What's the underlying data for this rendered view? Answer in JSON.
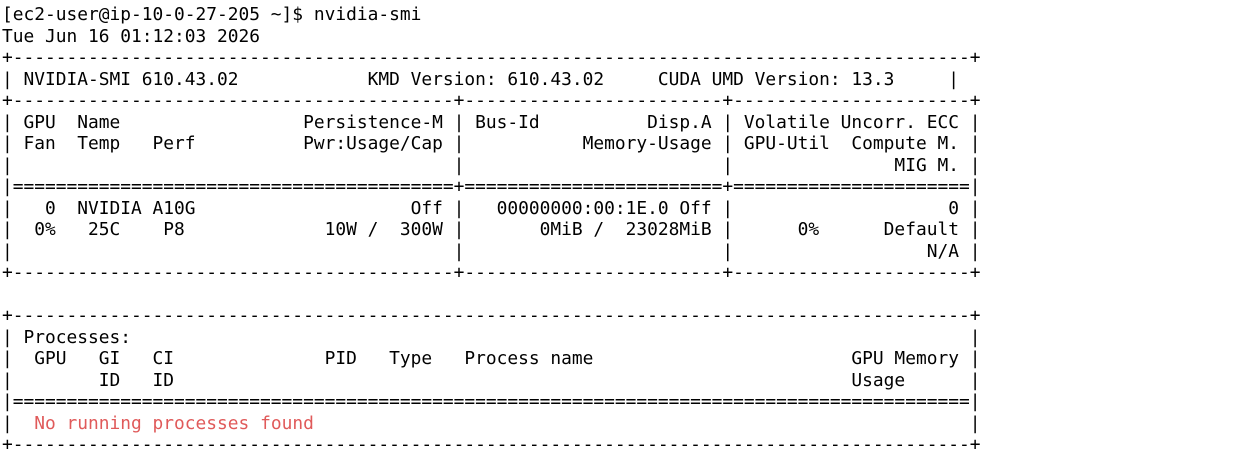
{
  "terminal": {
    "text_color": "#000000",
    "background_color": "#ffffff",
    "error_color": "#e05a5a",
    "lines": [
      {
        "text": "[ec2-user@ip-10-0-27-205 ~]$ nvidia-smi"
      },
      {
        "text": "Tue Jun 16 01:12:03 2026"
      },
      {
        "text": "+-----------------------------------------------------------------------------------------+"
      },
      {
        "text": "| NVIDIA-SMI 610.43.02            KMD Version: 610.43.02     CUDA UMD Version: 13.3     |"
      },
      {
        "text": "+-----------------------------------------+------------------------+----------------------+"
      },
      {
        "text": "| GPU  Name                 Persistence-M | Bus-Id          Disp.A | Volatile Uncorr. ECC |"
      },
      {
        "text": "| Fan  Temp   Perf          Pwr:Usage/Cap |           Memory-Usage | GPU-Util  Compute M. |"
      },
      {
        "text": "|                                         |                        |               MIG M. |"
      },
      {
        "text": "|=========================================+========================+======================|"
      },
      {
        "text": "|   0  NVIDIA A10G                    Off |   00000000:00:1E.0 Off |                    0 |"
      },
      {
        "text": "|  0%   25C    P8             10W /  300W |       0MiB /  23028MiB |      0%      Default |"
      },
      {
        "text": "|                                         |                        |                  N/A |"
      },
      {
        "text": "+-----------------------------------------+------------------------+----------------------+"
      },
      {
        "text": ""
      },
      {
        "text": "+-----------------------------------------------------------------------------------------+"
      },
      {
        "text": "| Processes:                                                                              |"
      },
      {
        "text": "|  GPU   GI   CI              PID   Type   Process name                        GPU Memory |"
      },
      {
        "text": "|        ID   ID                                                               Usage      |"
      },
      {
        "text": "|=========================================================================================|"
      },
      {
        "text": "|  No running processes found                                                             |",
        "style": "error-segment"
      },
      {
        "text": "+-----------------------------------------------------------------------------------------+"
      }
    ]
  }
}
